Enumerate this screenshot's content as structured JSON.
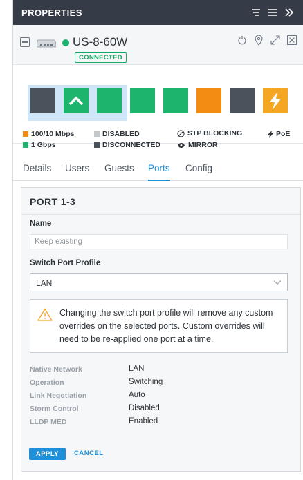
{
  "header": {
    "title": "PROPERTIES",
    "icons": [
      "filter-icon",
      "menu-icon",
      "collapse-panel-icon"
    ]
  },
  "device": {
    "name": "US-8-60W",
    "status": "CONNECTED",
    "status_color": "#1db46e",
    "actions": [
      "power-icon",
      "locate-icon",
      "expand-icon",
      "close-icon"
    ]
  },
  "ports": [
    {
      "id": 1,
      "state": "disconnected",
      "color": "#4a525c"
    },
    {
      "id": 2,
      "state": "1 Gbps uplink",
      "color": "#1db46e",
      "icon": "uplink-chevron-icon"
    },
    {
      "id": 3,
      "state": "1 Gbps",
      "color": "#1db46e"
    },
    {
      "id": 4,
      "state": "1 Gbps",
      "color": "#1db46e"
    },
    {
      "id": 5,
      "state": "1 Gbps",
      "color": "#1db46e"
    },
    {
      "id": 6,
      "state": "100/10 Mbps",
      "color": "#f28c13"
    },
    {
      "id": 7,
      "state": "disconnected",
      "color": "#4a525c"
    },
    {
      "id": 8,
      "state": "PoE",
      "color": "#f5a623",
      "icon": "poe-bolt-icon"
    }
  ],
  "legend": {
    "speed_100": {
      "label": "100/10 Mbps",
      "color": "#f28c13"
    },
    "speed_1g": {
      "label": "1 Gbps",
      "color": "#1db46e"
    },
    "disabled": {
      "label": "DISABLED",
      "color": "#c4c8cd"
    },
    "disconnected": {
      "label": "DISCONNECTED",
      "color": "#4a525c"
    },
    "stp": {
      "label": "STP BLOCKING"
    },
    "mirror": {
      "label": "MIRROR"
    },
    "poe": {
      "label": "PoE"
    }
  },
  "tabs": [
    {
      "label": "Details",
      "active": false
    },
    {
      "label": "Users",
      "active": false
    },
    {
      "label": "Guests",
      "active": false
    },
    {
      "label": "Ports",
      "active": true
    },
    {
      "label": "Config",
      "active": false
    }
  ],
  "panel": {
    "title": "PORT 1-3",
    "name_label": "Name",
    "name_placeholder": "Keep existing",
    "profile_label": "Switch Port Profile",
    "profile_value": "LAN",
    "warning": "Changing the switch port profile will remove any custom overrides on the selected ports. Custom overrides will need to be re-applied one port at a time.",
    "properties": [
      {
        "key": "Native Network",
        "value": "LAN"
      },
      {
        "key": "Operation",
        "value": "Switching"
      },
      {
        "key": "Link Negotiation",
        "value": "Auto"
      },
      {
        "key": "Storm Control",
        "value": "Disabled"
      },
      {
        "key": "LLDP MED",
        "value": "Enabled"
      }
    ],
    "apply_label": "APPLY",
    "cancel_label": "CANCEL"
  },
  "colors": {
    "accent": "#1e8fd8",
    "header_bg": "#353c47",
    "warning": "#f5a623"
  }
}
